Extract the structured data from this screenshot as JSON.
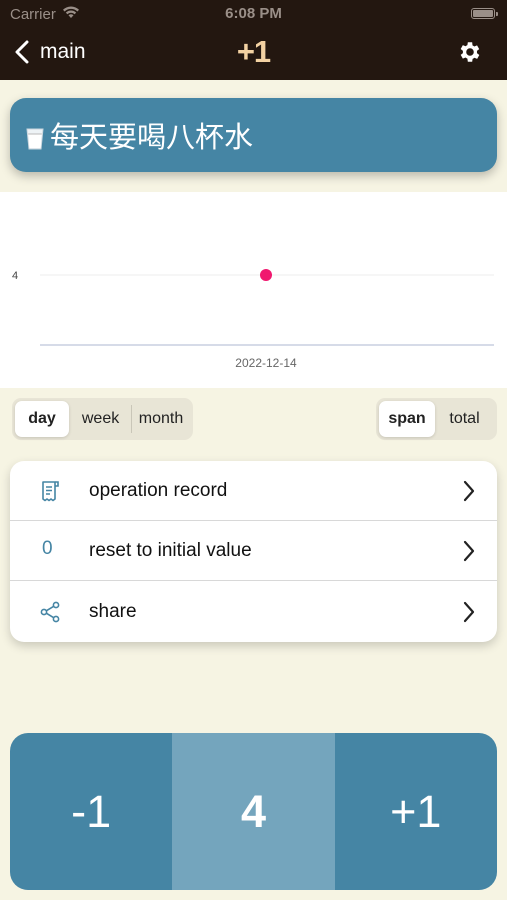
{
  "status": {
    "carrier": "Carrier",
    "time": "6:08 PM"
  },
  "nav": {
    "back_label": "main",
    "logo": "+1",
    "settings_icon": "gear-icon"
  },
  "title": {
    "text": "每天要喝八杯水",
    "icon": "glass-of-milk-icon"
  },
  "chart_data": {
    "type": "scatter",
    "x": [
      "2022-12-14"
    ],
    "y": [
      4
    ],
    "y_ticks": [
      4
    ],
    "x_ticks": [
      "2022-12-14"
    ],
    "point_color": "#f0186f",
    "grid": true
  },
  "range_tabs": [
    {
      "label": "day",
      "active": true
    },
    {
      "label": "week",
      "active": false
    },
    {
      "label": "month",
      "active": false
    }
  ],
  "mode_tabs": [
    {
      "label": "span",
      "active": true
    },
    {
      "label": "total",
      "active": false
    }
  ],
  "menu": {
    "items": [
      {
        "label": "operation record",
        "icon": "receipt-icon"
      },
      {
        "label": "reset to initial value",
        "icon_text": "0"
      },
      {
        "label": "share",
        "icon": "share-icon"
      }
    ]
  },
  "counter": {
    "minus": "-1",
    "value": "4",
    "plus": "+1"
  },
  "colors": {
    "accent": "#4585a4",
    "accent_light": "#74a5bd",
    "background": "#f6f4e3",
    "navbar": "#231710",
    "logo": "#f3d2a3"
  }
}
